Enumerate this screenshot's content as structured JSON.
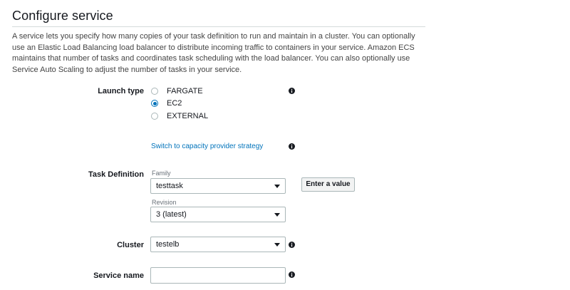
{
  "header": {
    "title": "Configure service",
    "description": "A service lets you specify how many copies of your task definition to run and maintain in a cluster. You can optionally use an Elastic Load Balancing load balancer to distribute incoming traffic to containers in your service. Amazon ECS maintains that number of tasks and coordinates task scheduling with the load balancer. You can also optionally use Service Auto Scaling to adjust the number of tasks in your service."
  },
  "launch_type": {
    "label": "Launch type",
    "options": [
      {
        "label": "FARGATE",
        "selected": false
      },
      {
        "label": "EC2",
        "selected": true
      },
      {
        "label": "EXTERNAL",
        "selected": false
      }
    ],
    "switch_link": "Switch to capacity provider strategy"
  },
  "task_definition": {
    "label": "Task Definition",
    "family_label": "Family",
    "family_value": "testtask",
    "revision_label": "Revision",
    "revision_value": "3 (latest)",
    "enter_value_button": "Enter a value"
  },
  "cluster": {
    "label": "Cluster",
    "value": "testelb"
  },
  "service_name": {
    "label": "Service name",
    "value": ""
  },
  "icons": {
    "info": "info-circle-icon",
    "dropdown": "caret-down-icon"
  },
  "colors": {
    "accent": "#0073bb",
    "text": "#16191f",
    "border": "#aab7b8",
    "button_bg": "#f2f3f3"
  }
}
